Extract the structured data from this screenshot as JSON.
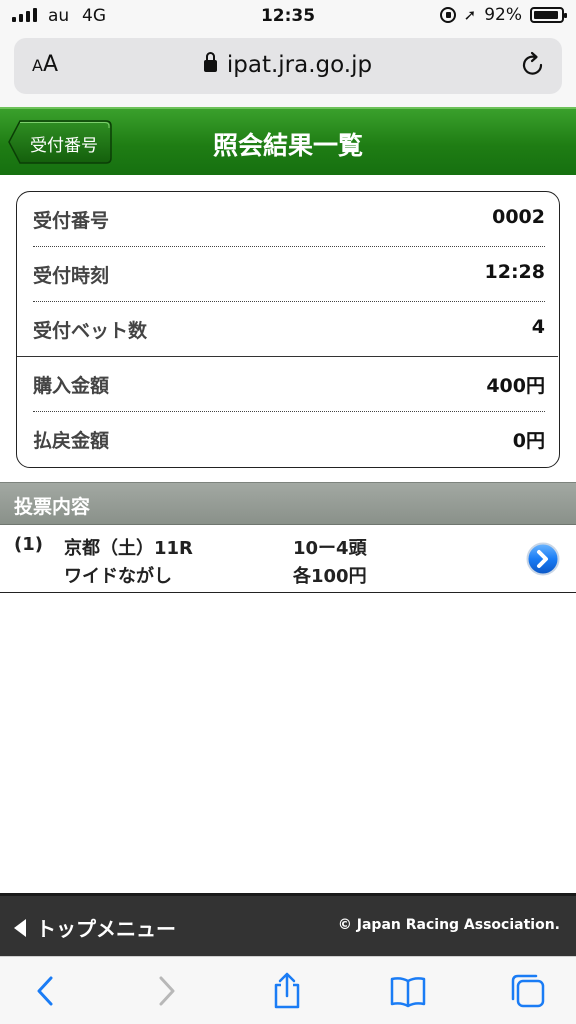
{
  "status_bar": {
    "carrier": "au",
    "network": "4G",
    "time": "12:35",
    "battery": "92%",
    "battery_level": 0.92
  },
  "browser": {
    "text_size_label": "AA",
    "url": "ipat.jra.go.jp"
  },
  "header": {
    "back_label": "受付番号",
    "title": "照会結果一覧"
  },
  "receipt": {
    "rows": [
      {
        "label": "受付番号",
        "value": "0002"
      },
      {
        "label": "受付時刻",
        "value": "12:28"
      },
      {
        "label": "受付ベット数",
        "value": "4"
      },
      {
        "label": "購入金額",
        "value": "400円"
      },
      {
        "label": "払戻金額",
        "value": "0円"
      }
    ]
  },
  "section": {
    "title": "投票内容"
  },
  "bets": [
    {
      "index": "(1)",
      "race": "京都（土）11R",
      "bet_type": "ワイドながし",
      "combination": "10ー4頭",
      "amount": "各100円"
    }
  ],
  "footer": {
    "top_menu": "トップメニュー",
    "copyright": "© Japan Racing Association."
  },
  "colors": {
    "header_green": "#1f7d14",
    "section_gray": "#8a918a",
    "footer_dark": "#333333",
    "ios_blue": "#1a7cf5"
  }
}
